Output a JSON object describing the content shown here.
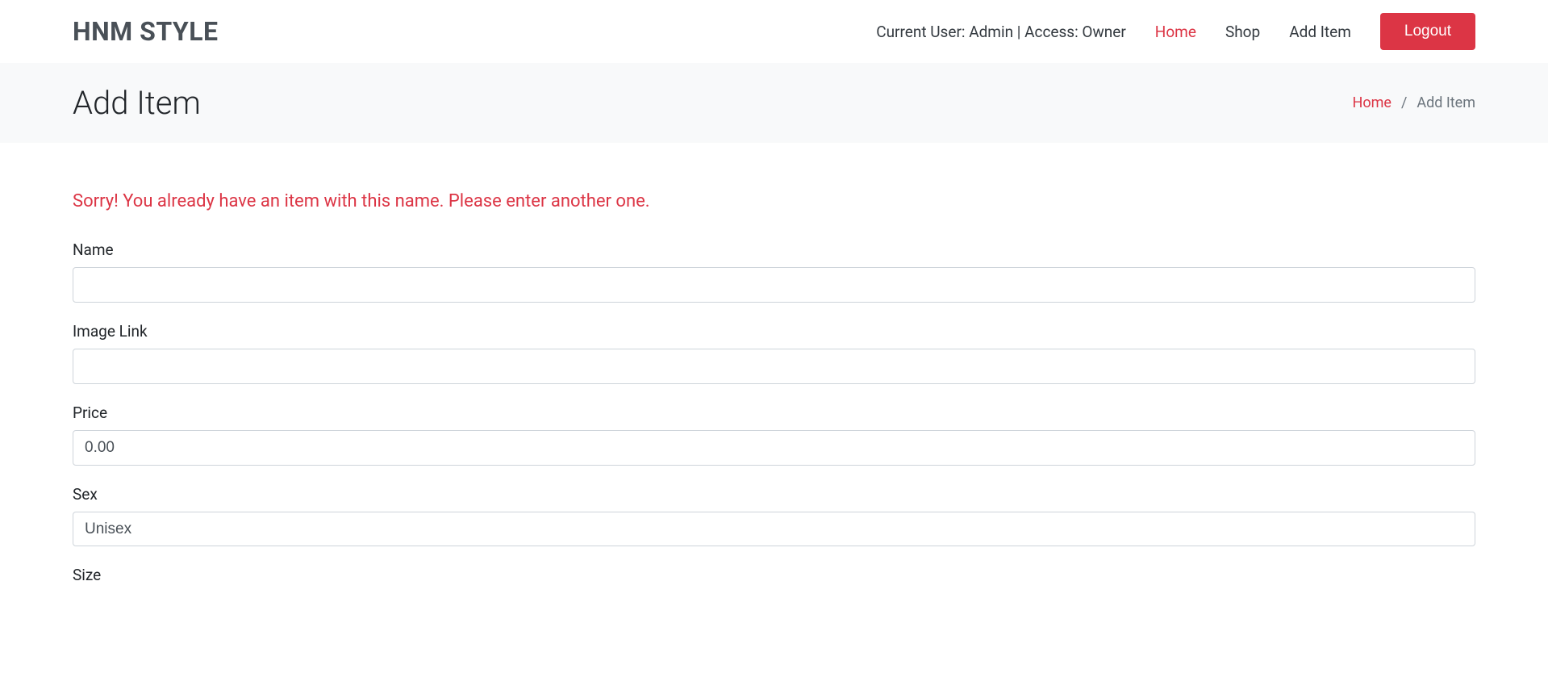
{
  "header": {
    "brand": "HNM STYLE",
    "user_info": "Current User: Admin | Access: Owner",
    "nav": {
      "home": "Home",
      "shop": "Shop",
      "add_item": "Add Item"
    },
    "logout": "Logout"
  },
  "breadcrumb": {
    "title": "Add Item",
    "home": "Home",
    "separator": "/",
    "current": "Add Item"
  },
  "error": "Sorry! You already have an item with this name. Please enter another one.",
  "form": {
    "name": {
      "label": "Name",
      "value": ""
    },
    "image_link": {
      "label": "Image Link",
      "value": ""
    },
    "price": {
      "label": "Price",
      "value": "0.00"
    },
    "sex": {
      "label": "Sex",
      "value": "Unisex"
    },
    "size": {
      "label": "Size"
    }
  }
}
